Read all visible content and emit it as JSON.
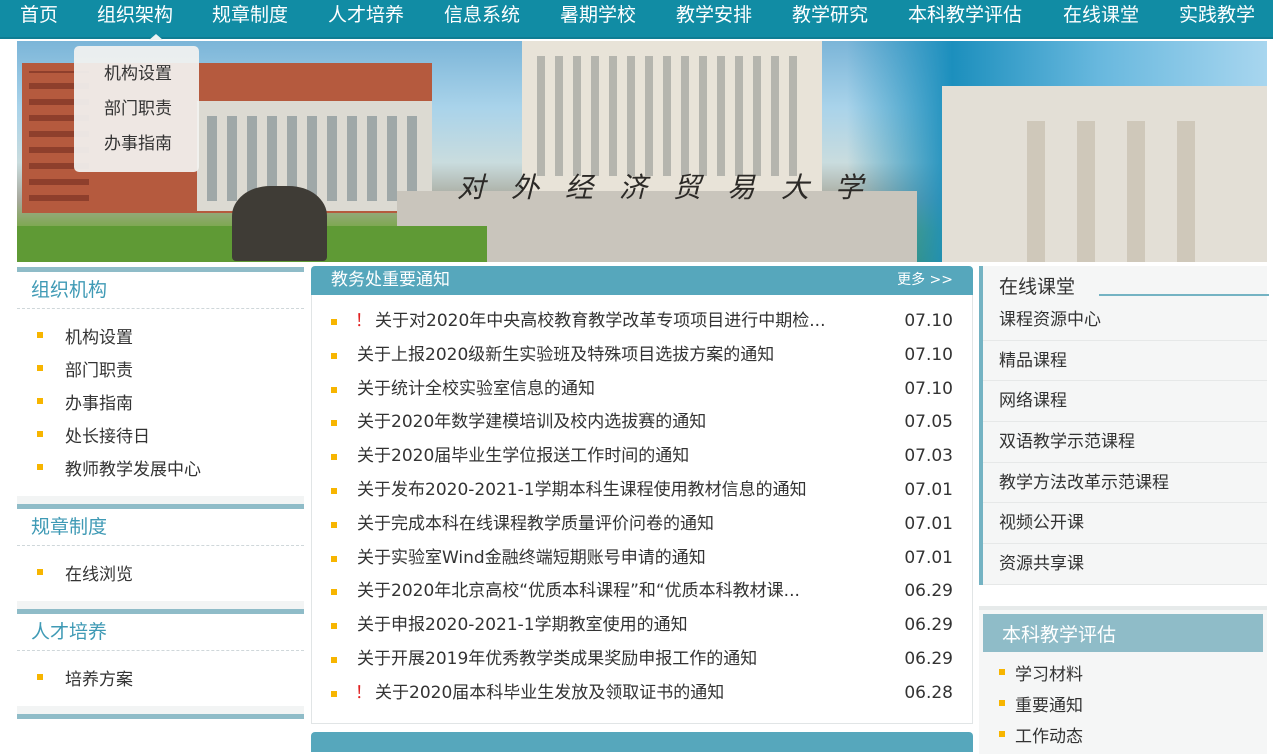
{
  "nav": {
    "items": [
      "首页",
      "组织架构",
      "规章制度",
      "人才培养",
      "信息系统",
      "暑期学校",
      "教学安排",
      "教学研究",
      "本科教学评估",
      "在线课堂",
      "实践教学"
    ]
  },
  "banner": {
    "calligraphy": "对外经济贸易大学"
  },
  "dropdown": {
    "items": [
      "机构设置",
      "部门职责",
      "办事指南"
    ]
  },
  "left": {
    "org": {
      "title": "组织机构",
      "items": [
        "机构设置",
        "部门职责",
        "办事指南",
        "处长接待日",
        "教师教学发展中心"
      ]
    },
    "rules": {
      "title": "规章制度",
      "items": [
        "在线浏览"
      ]
    },
    "talent": {
      "title": "人才培养",
      "items": [
        "培养方案"
      ]
    }
  },
  "notices": {
    "title": "教务处重要通知",
    "more": "更多 >>",
    "items": [
      {
        "important": true,
        "mark": "！",
        "title": "关于对2020年中央高校教育教学改革专项项目进行中期检...",
        "date": "07.10"
      },
      {
        "important": false,
        "mark": "",
        "title": "关于上报2020级新生实验班及特殊项目选拔方案的通知",
        "date": "07.10"
      },
      {
        "important": false,
        "mark": "",
        "title": "关于统计全校实验室信息的通知",
        "date": "07.10"
      },
      {
        "important": false,
        "mark": "",
        "title": "关于2020年数学建模培训及校内选拔赛的通知",
        "date": "07.05"
      },
      {
        "important": false,
        "mark": "",
        "title": "关于2020届毕业生学位报送工作时间的通知",
        "date": "07.03"
      },
      {
        "important": false,
        "mark": "",
        "title": "关于发布2020-2021-1学期本科生课程使用教材信息的通知",
        "date": "07.01"
      },
      {
        "important": false,
        "mark": "",
        "title": "关于完成本科在线课程教学质量评价问卷的通知",
        "date": "07.01"
      },
      {
        "important": false,
        "mark": "",
        "title": "关于实验室Wind金融终端短期账号申请的通知",
        "date": "07.01"
      },
      {
        "important": false,
        "mark": "",
        "title": "关于2020年北京高校“优质本科课程”和“优质本科教材课...",
        "date": "06.29"
      },
      {
        "important": false,
        "mark": "",
        "title": "关于申报2020-2021-1学期教室使用的通知",
        "date": "06.29"
      },
      {
        "important": false,
        "mark": "",
        "title": "关于开展2019年优秀教学类成果奖励申报工作的通知",
        "date": "06.29"
      },
      {
        "important": true,
        "mark": "！",
        "title": "关于2020届本科毕业生发放及领取证书的通知",
        "date": "06.28"
      }
    ]
  },
  "online": {
    "title": "在线课堂",
    "items": [
      "课程资源中心",
      "精品课程",
      "网络课程",
      "双语教学示范课程",
      "教学方法改革示范课程",
      "视频公开课",
      "资源共享课"
    ]
  },
  "eval": {
    "title": "本科教学评估",
    "items": [
      "学习材料",
      "重要通知",
      "工作动态"
    ]
  },
  "colors": {
    "nav_bg": "#118ca4",
    "accent": "#56a7bc",
    "bullet": "#f7b500",
    "important": "#e01f1f"
  }
}
